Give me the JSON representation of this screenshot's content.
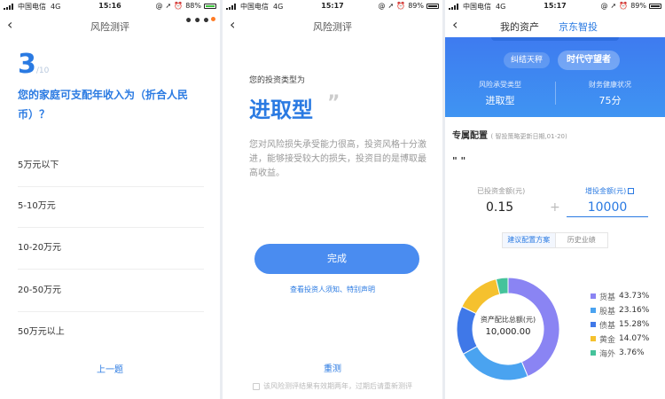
{
  "statusbars": [
    {
      "carrier": "中国电信",
      "network": "4G",
      "time": "15:16",
      "battery": "88%"
    },
    {
      "carrier": "中国电信",
      "network": "4G",
      "time": "15:17",
      "battery": "89%"
    },
    {
      "carrier": "中国电信",
      "network": "4G",
      "time": "15:17",
      "battery": "89%"
    }
  ],
  "screen1": {
    "title": "风险测评",
    "more": "•••",
    "question_number": "3",
    "question_total": "/10",
    "question": "您的家庭可支配年收入为（折合人民币）？",
    "options": [
      "5万元以下",
      "5-10万元",
      "10-20万元",
      "20-50万元",
      "50万元以上"
    ],
    "prev_label": "上一题"
  },
  "screen2": {
    "title": "风险测评",
    "type_label": "您的投资类型为",
    "type_value": "进取型",
    "quote_mark": "”",
    "description": "您对风险损失承受能力很高，投资风格十分激进，能够接受较大的损失，投资目的是博取最高收益。",
    "done_label": "完成",
    "link_label": "查看投资人须知、特别声明",
    "retest_label": "重测",
    "note": "该风险测评结果有效期两年，过期后请重新测评"
  },
  "screen3": {
    "title_left": "我的资产",
    "title_right": "京东智投",
    "pill_left": "纠结天秤",
    "pill_right": "时代守望者",
    "risk_label": "风险承受类型",
    "risk_value": "进取型",
    "health_label": "财务健康状况",
    "health_value": "75分",
    "section_title": "专属配置",
    "section_sub": "( 智投策略更新日期,01-20)",
    "quote_marks": "\" \"",
    "invested_label": "已投资金额(元)",
    "invested_value": "0.15",
    "plus": "+",
    "add_label": "增投金额(元)",
    "add_value": "10000",
    "tab_active": "建议配置方案",
    "tab_inactive": "历史业绩",
    "center_label": "资产配比总额(元)",
    "center_value": "10,000.00"
  },
  "chart_data": {
    "type": "pie",
    "categories": [
      "货基",
      "股基",
      "债基",
      "黄金",
      "海外"
    ],
    "values": [
      43.73,
      23.16,
      15.28,
      14.07,
      3.76
    ],
    "labels": [
      "43.73%",
      "23.16%",
      "15.28%",
      "14.07%",
      "3.76%"
    ],
    "colors": [
      "#8a84f3",
      "#4aa3f0",
      "#3f78e8",
      "#f5c12e",
      "#45c39b"
    ],
    "donut": true,
    "legend_position": "right"
  }
}
